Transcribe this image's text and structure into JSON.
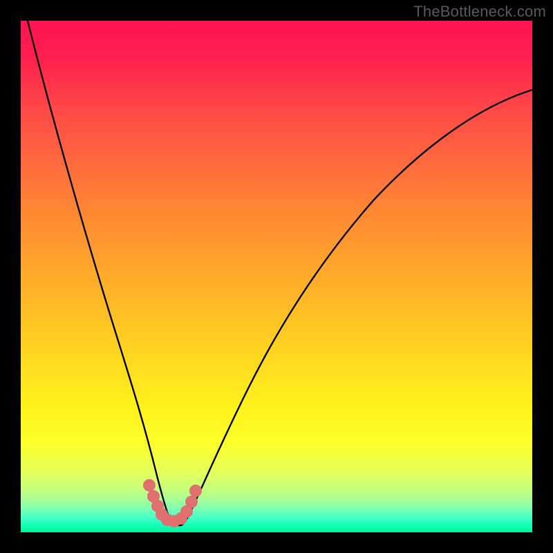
{
  "watermark": {
    "text": "TheBottleneck.com"
  },
  "chart_data": {
    "type": "line",
    "title": "",
    "xlabel": "",
    "ylabel": "",
    "xlim": [
      0,
      100
    ],
    "ylim": [
      0,
      100
    ],
    "grid": false,
    "legend": false,
    "background_gradient": {
      "orientation": "vertical",
      "stops": [
        {
          "pos": 0,
          "color": "#ff1452"
        },
        {
          "pos": 0.25,
          "color": "#ff6b3d"
        },
        {
          "pos": 0.55,
          "color": "#ffd81f"
        },
        {
          "pos": 0.8,
          "color": "#fbff2c"
        },
        {
          "pos": 0.95,
          "color": "#8affab"
        },
        {
          "pos": 1.0,
          "color": "#00f59e"
        }
      ]
    },
    "series": [
      {
        "name": "bottleneck-curve",
        "color": "#000000",
        "x": [
          1,
          3,
          6,
          10,
          14,
          18,
          22,
          24,
          26,
          27,
          28,
          30,
          32,
          34,
          38,
          44,
          52,
          62,
          74,
          88,
          100
        ],
        "y": [
          100,
          88,
          74,
          58,
          42,
          27,
          14,
          8,
          4,
          2,
          2,
          2,
          4,
          8,
          16,
          28,
          42,
          56,
          68,
          78,
          84
        ]
      }
    ],
    "markers": [
      {
        "name": "highlight-dots",
        "color": "#e57373",
        "radius_px": 9,
        "points": [
          {
            "x": 24.0,
            "y": 7.5
          },
          {
            "x": 25.0,
            "y": 5.0
          },
          {
            "x": 26.0,
            "y": 3.2
          },
          {
            "x": 27.0,
            "y": 2.2
          },
          {
            "x": 28.5,
            "y": 1.8
          },
          {
            "x": 30.0,
            "y": 1.8
          },
          {
            "x": 31.5,
            "y": 2.6
          },
          {
            "x": 32.5,
            "y": 4.2
          },
          {
            "x": 33.5,
            "y": 6.5
          },
          {
            "x": 34.5,
            "y": 9.0
          }
        ]
      }
    ]
  }
}
